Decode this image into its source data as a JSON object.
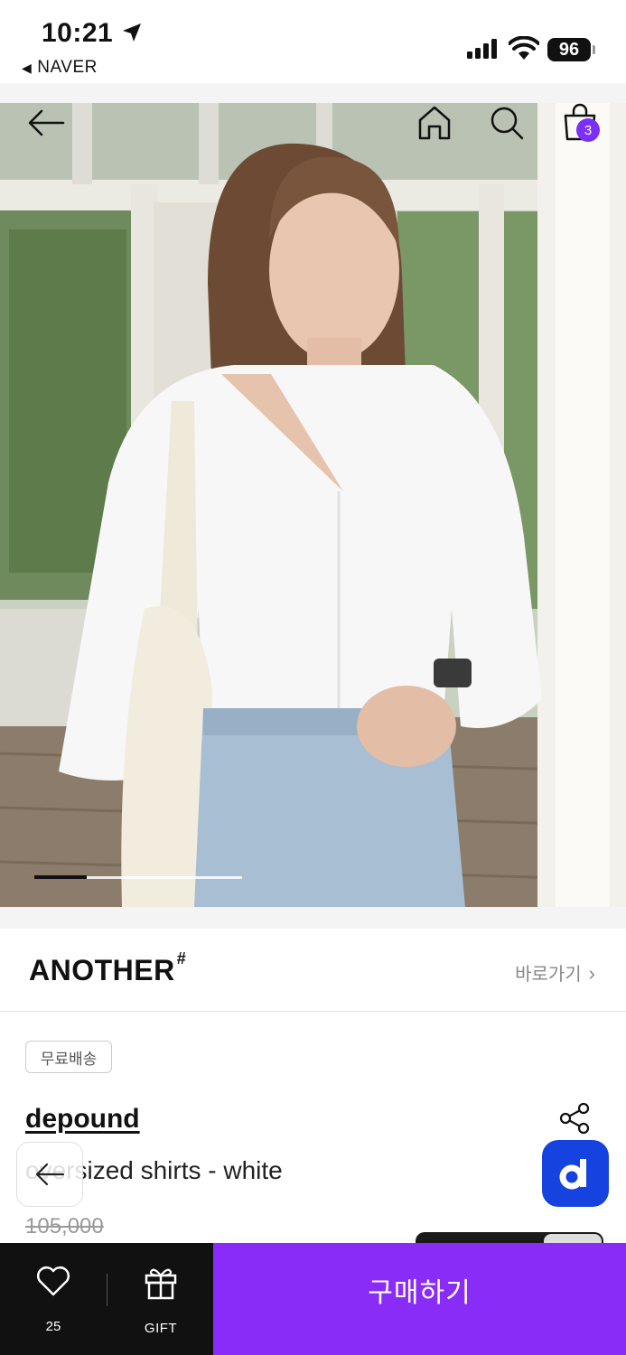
{
  "status_bar": {
    "time": "10:21",
    "back_app": "NAVER",
    "battery": "96",
    "location_icon": "location-arrow-icon",
    "signal_icon": "cellular-signal-icon",
    "wifi_icon": "wifi-icon"
  },
  "header": {
    "back_icon": "arrow-left-icon",
    "home_icon": "home-icon",
    "search_icon": "search-icon",
    "cart_icon": "shopping-bag-icon",
    "cart_count": "3"
  },
  "gallery": {
    "current_index": 1,
    "progress_fraction": 0.25
  },
  "brand": {
    "name": "ANOTHER",
    "mark": "#",
    "link_label": "바로가기"
  },
  "product": {
    "badge": "무료배송",
    "seller": "depound",
    "name": "oversized shirts - white",
    "original_price": "105,000",
    "share_icon": "share-icon"
  },
  "floating": {
    "back_icon": "arrow-left-icon",
    "app_badge_letter": "d"
  },
  "bottom_bar": {
    "like_count": "25",
    "gift_label": "GIFT",
    "buy_label": "구매하기"
  },
  "colors": {
    "accent": "#8a2cf8",
    "badge_purple": "#7b2ff7",
    "app_badge_blue": "#1643e0"
  }
}
